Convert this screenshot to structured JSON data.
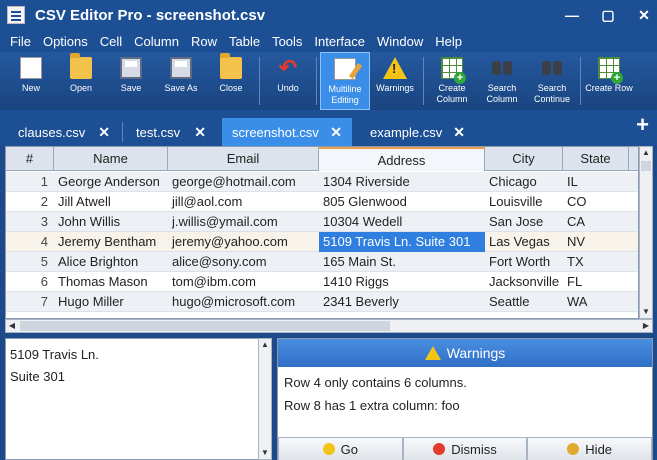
{
  "window": {
    "title": "CSV Editor Pro - screenshot.csv",
    "controls": [
      "—",
      "▢",
      "✕"
    ]
  },
  "menu": [
    "File",
    "Options",
    "Cell",
    "Column",
    "Row",
    "Table",
    "Tools",
    "Interface",
    "Window",
    "Help"
  ],
  "toolbar": [
    {
      "label": "New",
      "icon": "new-document-icon"
    },
    {
      "label": "Open",
      "icon": "open-folder-icon"
    },
    {
      "label": "Save",
      "icon": "save-disk-icon"
    },
    {
      "label": "Save As",
      "icon": "save-as-icon"
    },
    {
      "label": "Close",
      "icon": "close-folder-icon"
    },
    {
      "label": "Undo",
      "icon": "undo-arrow-icon"
    },
    {
      "label": "Multiline Editing",
      "icon": "multiline-edit-icon",
      "active": true
    },
    {
      "label": "Warnings",
      "icon": "warning-icon"
    },
    {
      "label": "Create Column",
      "icon": "create-column-icon"
    },
    {
      "label": "Search Column",
      "icon": "binoculars-icon"
    },
    {
      "label": "Search Continue",
      "icon": "binoculars-plus-icon"
    },
    {
      "label": "Create Row",
      "icon": "create-row-icon"
    }
  ],
  "tabs": [
    {
      "label": "clauses.csv",
      "close": "✕"
    },
    {
      "label": "test.csv",
      "close": "✕"
    },
    {
      "label": "screenshot.csv",
      "close": "✕",
      "active": true
    },
    {
      "label": "example.csv",
      "close": "✕"
    }
  ],
  "add_tab": "+",
  "grid": {
    "headers": [
      "#",
      "Name",
      "Email",
      "Address",
      "City",
      "State"
    ],
    "selected_header": "Address",
    "rows": [
      [
        "1",
        "George Anderson",
        "george@hotmail.com",
        "1304 Riverside",
        "Chicago",
        "IL"
      ],
      [
        "2",
        "Jill Atwell",
        "jill@aol.com",
        "805 Glenwood",
        "Louisville",
        "CO"
      ],
      [
        "3",
        "John Willis",
        "j.willis@ymail.com",
        "10304 Wedell",
        "San Jose",
        "CA"
      ],
      [
        "4",
        "Jeremy Bentham",
        "jeremy@yahoo.com",
        "5109 Travis Ln. Suite 301",
        "Las Vegas",
        "NV"
      ],
      [
        "5",
        "Alice Brighton",
        "alice@sony.com",
        "165 Main St.",
        "Fort Worth",
        "TX"
      ],
      [
        "6",
        "Thomas Mason",
        "tom@ibm.com",
        "1410 Riggs",
        "Jacksonville",
        "FL"
      ],
      [
        "7",
        "Hugo Miller",
        "hugo@microsoft.com",
        "2341 Beverly",
        "Seattle",
        "WA"
      ]
    ],
    "active_row": 4,
    "active_column": "Address"
  },
  "detail": {
    "lines": [
      "5109 Travis Ln.",
      "Suite 301"
    ]
  },
  "warnings": {
    "title": "Warnings",
    "messages": [
      "Row 4 only contains 6 columns.",
      "Row 8 has 1 extra column: foo"
    ],
    "buttons": [
      "Go",
      "Dismiss",
      "Hide"
    ]
  },
  "colors": {
    "chrome_blue": "#1d4f95",
    "active_blue": "#3b8ee8",
    "selection_blue": "#2f7fe0",
    "warning_yellow": "#f3c316"
  }
}
